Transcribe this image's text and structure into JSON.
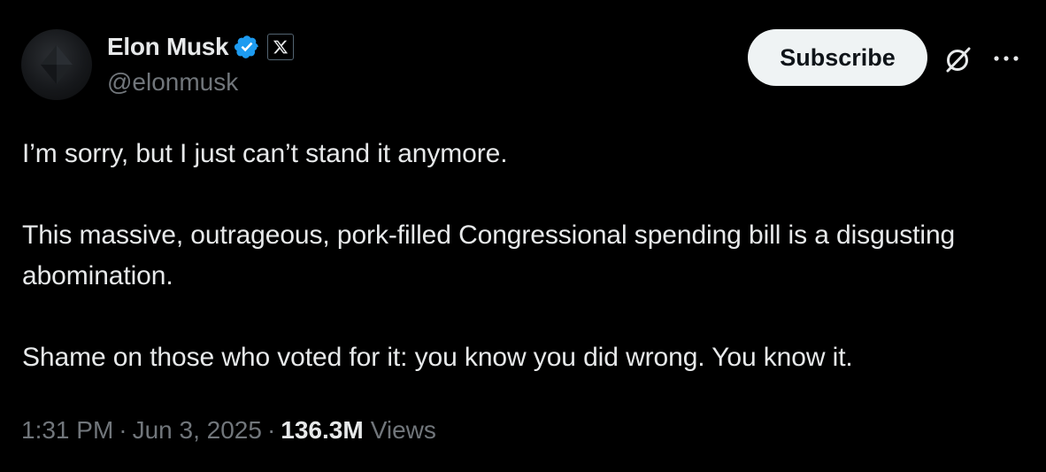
{
  "author": {
    "display_name": "Elon Musk",
    "handle": "@elonmusk",
    "verified_color": "#1d9bf0",
    "verified_icon": "verified-badge-icon",
    "affiliate_icon": "x-logo-icon"
  },
  "actions": {
    "subscribe_label": "Subscribe",
    "grok_icon": "grok-icon",
    "more_icon": "more-dots-icon"
  },
  "tweet": {
    "text": "I’m sorry, but I just can’t stand it anymore.\n\nThis massive, outrageous, pork-filled Congressional spending bill is a disgusting abomination.\n\nShame on those who voted for it: you know you did wrong. You know it."
  },
  "meta": {
    "time": "1:31 PM",
    "date": "Jun 3, 2025",
    "separator": "·",
    "views_count": "136.3M",
    "views_label": "Views"
  },
  "colors": {
    "background": "#000000",
    "primary_text": "#e7e9ea",
    "secondary_text": "#71767b",
    "button_bg": "#eff3f4"
  }
}
